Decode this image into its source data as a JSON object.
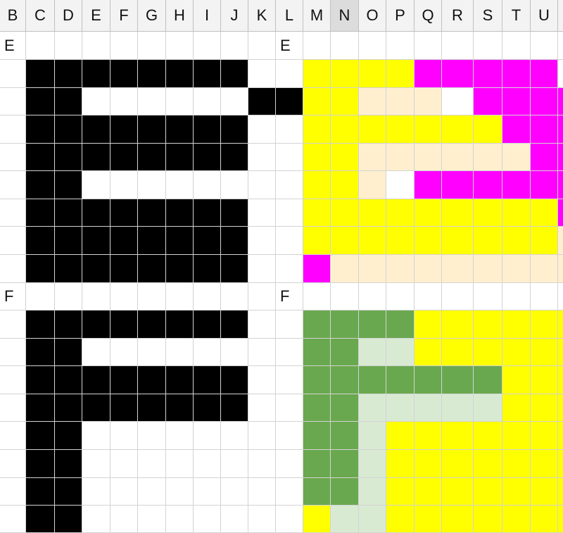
{
  "column_headers": [
    "B",
    "C",
    "D",
    "E",
    "F",
    "G",
    "H",
    "I",
    "J",
    "K",
    "L",
    "M",
    "N",
    "O",
    "P",
    "Q",
    "R",
    "S",
    "T",
    "U"
  ],
  "selected_column": "N",
  "blocks": [
    {
      "label": "E",
      "col": "B"
    },
    {
      "label": "E",
      "col": "L"
    },
    {
      "label": "F",
      "col": "B"
    },
    {
      "label": "F",
      "col": "L"
    }
  ],
  "palette": {
    ".": "#ffffff",
    "k": "#000000",
    "y": "#ffff00",
    "m": "#ff00ff",
    "c": "#ffefcf",
    "g": "#6aa84f",
    "l": "#d9ead3"
  },
  "grid_rows": [
    "....................",
    ".kkkkkkkk..yyyymmmmm",
    ".kk......kkyyccc.mmmm",
    ".kkkkkkkk..yyyyyyymmm",
    ".kkkkkkkk..yyccccccmm",
    ".kk........yyc.mmmmmm",
    ".kkkkkkkk..yyyyyyyyym",
    ".kkkkkkkk..yyyyyyyyyc",
    ".kkkkkkkk..mcccccccccc",
    "....................",
    ".kkkkkkkk..ggggyyyyyy",
    ".kk........ggllyyyyyy",
    ".kkkkkkkk..gggggggyyy",
    ".kkkkkkkk..gglllllyyy",
    ".kk........gglyyyyyyy",
    ".kk........gglyyyyyyy",
    ".kk........gglyyyyyyy",
    ".kk........yllyyyyyyy"
  ]
}
